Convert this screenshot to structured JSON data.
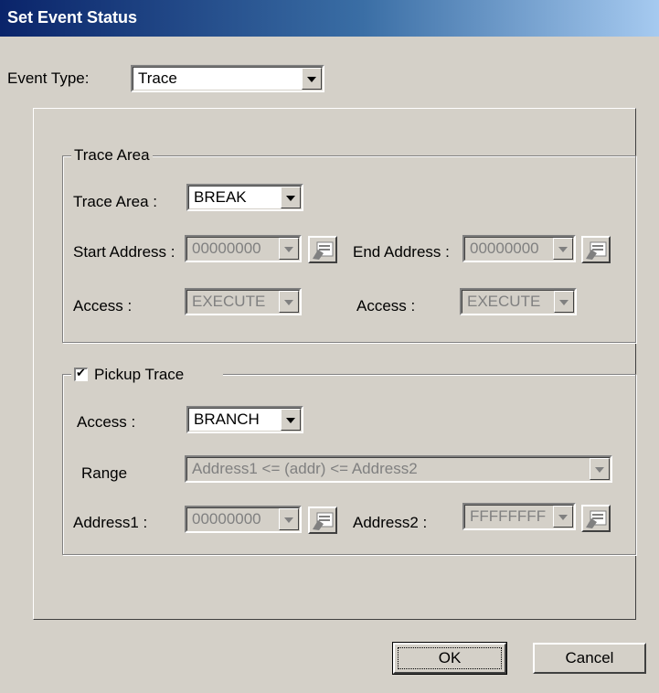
{
  "dialog": {
    "title": "Set Event Status"
  },
  "event_type": {
    "label": "Event Type:",
    "value": "Trace"
  },
  "trace_area": {
    "group_label": "Trace Area",
    "area_label": "Trace Area :",
    "area_value": "BREAK",
    "start_address_label": "Start Address :",
    "start_address_value": "00000000",
    "end_address_label": "End Address :",
    "end_address_value": "00000000",
    "access_label_1": "Access :",
    "access_value_1": "EXECUTE",
    "access_label_2": "Access :",
    "access_value_2": "EXECUTE"
  },
  "pickup_trace": {
    "group_label": "Pickup Trace",
    "checked": true,
    "check_mark": "✔",
    "access_label": "Access :",
    "access_value": "BRANCH",
    "range_label": "Range",
    "range_value": "Address1 <= (addr) <= Address2",
    "address1_label": "Address1 :",
    "address1_value": "00000000",
    "address2_label": "Address2 :",
    "address2_value": "FFFFFFFF"
  },
  "buttons": {
    "ok": "OK",
    "cancel": "Cancel"
  },
  "icons": {
    "address_picker": "address-picker-icon"
  }
}
